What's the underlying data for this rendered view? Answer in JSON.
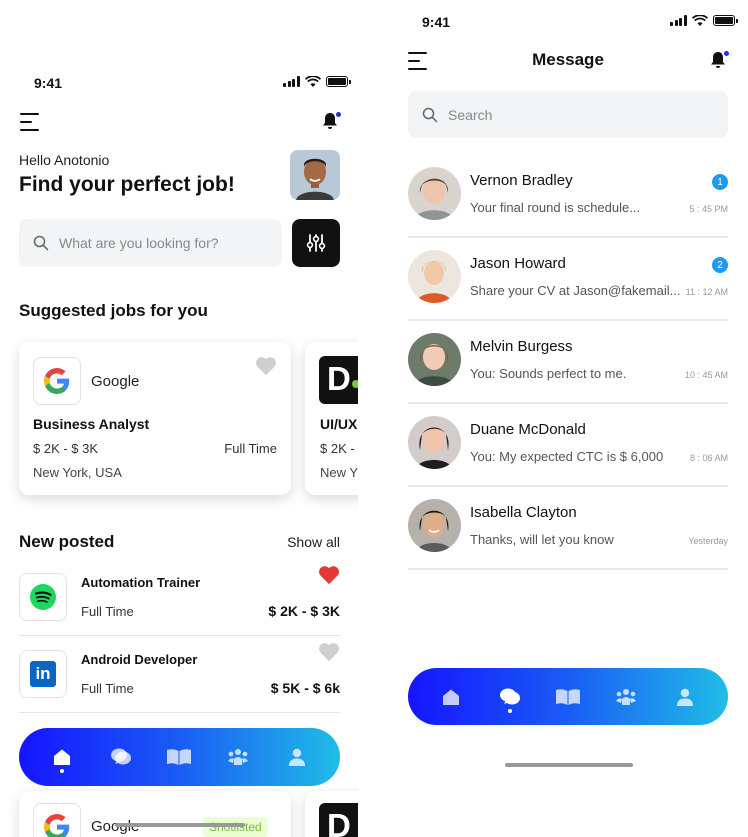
{
  "left": {
    "status_time": "9:41",
    "greeting": "Hello Anotonio",
    "headline": "Find your perfect job!",
    "search_placeholder": "What are you looking for?",
    "suggested_title": "Suggested jobs for you",
    "suggested": [
      {
        "company": "Google",
        "title": "Business Analyst",
        "salary": "$ 2K - $ 3K",
        "type": "Full Time",
        "location": "New York, USA",
        "logo": "google-logo"
      },
      {
        "company": "",
        "title": "UI/UX",
        "salary": "$ 2K -",
        "type": "",
        "location": "New Y",
        "logo": "dribbble-logo",
        "logo_letter": "D"
      }
    ],
    "new_posted_title": "New posted",
    "show_all": "Show all",
    "new_posted": [
      {
        "title": "Automation Trainer",
        "type": "Full Time",
        "salary": "$ 2K - $ 3K",
        "logo": "spotify-logo",
        "favorite": true
      },
      {
        "title": "Android Developer",
        "type": "Full Time",
        "salary": "$ 5K -  $ 6k",
        "logo": "linkedin-logo",
        "logo_text": "in",
        "favorite": false
      }
    ],
    "bottom_card": {
      "company": "Google",
      "badge": "Shotlisted"
    },
    "bottom_card_2_letter": "D"
  },
  "right": {
    "status_time": "9:41",
    "title": "Message",
    "search_placeholder": "Search",
    "conversations": [
      {
        "name": "Vernon Bradley",
        "preview": "Your final round is schedule...",
        "time": "5 : 45 PM",
        "badge": "1"
      },
      {
        "name": "Jason Howard",
        "preview": "Share your CV at Jason@fakemail...",
        "time": "11 : 12 AM",
        "badge": "2"
      },
      {
        "name": "Melvin Burgess",
        "preview": "You: Sounds perfect to me.",
        "time": "10 : 45 AM",
        "badge": ""
      },
      {
        "name": "Duane McDonald",
        "preview": "You: My expected CTC is $ 6,000",
        "time": "8 : 06 AM",
        "badge": ""
      },
      {
        "name": "Isabella Clayton",
        "preview": "Thanks, will let you know",
        "time": "Yesterday",
        "badge": ""
      }
    ]
  },
  "tabbar": {
    "tabs": [
      "home-icon",
      "chat-icon",
      "book-icon",
      "community-icon",
      "profile-icon"
    ]
  },
  "colors": {
    "accent_blue": "#1515ff",
    "accent_cyan": "#20bde6",
    "badge_blue": "#1e9bf0",
    "favorite_red": "#e53935"
  }
}
